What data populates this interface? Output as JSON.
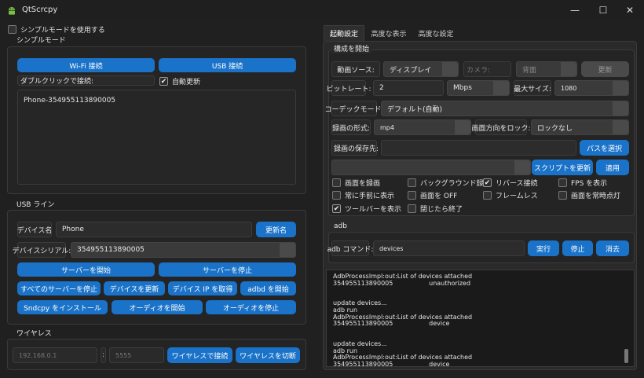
{
  "window": {
    "title": "QtScrcpy",
    "minimize": "—",
    "maximize": "☐",
    "close": "✕"
  },
  "simple_mode": {
    "checkbox_label": "シンプルモードを使用する",
    "group_title": "シンプルモード",
    "wifi_button": "Wi-Fi 接続",
    "usb_button": "USB 接続",
    "doubleclick_label": "ダブルクリックで接続:",
    "auto_update_label": "自動更新",
    "devices": [
      "Phone-354955113890005"
    ]
  },
  "usb_line": {
    "group_title": "USB ライン",
    "device_name_label": "デバイス名",
    "device_name_value": "Phone",
    "rename_button": "更新名",
    "serial_label": "デバイスシリアル:",
    "serial_value": "354955113890005",
    "start_server": "サーバーを開始",
    "stop_server": "サーバーを停止",
    "stop_all_servers": "すべてのサーバーを停止",
    "update_device": "デバイスを更新",
    "get_ip": "デバイス IP を取得",
    "start_adbd": "adbd を開始",
    "install_sndcpy": "Sndcpy をインストール",
    "start_audio": "オーディオを開始",
    "stop_audio": "オーディオを停止"
  },
  "wireless": {
    "group_title": "ワイヤレス",
    "ip_placeholder": "192.168.0.1",
    "separator": ":",
    "port_placeholder": "5555",
    "connect_button": "ワイヤレスで接続",
    "disconnect_button": "ワイヤレスを切断"
  },
  "tabs": [
    {
      "label": "起動設定",
      "active": true
    },
    {
      "label": "高度な表示",
      "active": false
    },
    {
      "label": "高度な設定",
      "active": false
    }
  ],
  "start_config": {
    "group_title": "構成を開始",
    "video_source_label": "動画ソース:",
    "video_source_value": "ディスプレイ",
    "camera_label": "カメラ:",
    "camera_position": "背面",
    "refresh_button": "更新",
    "bitrate_label": "ビットレート:",
    "bitrate_value": "2",
    "bitrate_unit": "Mbps",
    "max_size_label": "最大サイズ:",
    "max_size_value": "1080",
    "codec_label": "コーデックモード:",
    "codec_value": "デフォルト(自動)",
    "record_format_label": "録画の形式:",
    "record_format_value": "mp4",
    "lock_orientation_label": "画面方向をロック:",
    "lock_orientation_value": "ロックなし",
    "record_path_label": "録画の保存先:",
    "record_path_value": "",
    "select_path_button": "パスを選択",
    "script_value": "",
    "update_script_button": "スクリプトを更新",
    "apply_button": "適用",
    "options": [
      {
        "label": "画面を録画",
        "checked": false
      },
      {
        "label": "バックグラウンド録画",
        "checked": false
      },
      {
        "label": "リバース接続",
        "checked": true
      },
      {
        "label": "FPS を表示",
        "checked": false
      },
      {
        "label": "常に手前に表示",
        "checked": false
      },
      {
        "label": "画面を OFF",
        "checked": false
      },
      {
        "label": "フレームレス",
        "checked": false
      },
      {
        "label": "画面を常時点灯",
        "checked": false
      },
      {
        "label": "ツールバーを表示",
        "checked": true
      },
      {
        "label": "閉じたら終了",
        "checked": false
      }
    ]
  },
  "adb": {
    "group_title": "adb",
    "command_label": "adb コマンド:",
    "command_value": "devices",
    "execute_button": "実行",
    "stop_button": "停止",
    "clear_button": "消去"
  },
  "log_text": "AdbProcessImpl:out:List of devices attached\n354955113890005                  unauthorized\n\n\nupdate devices...\nadb run\nAdbProcessImpl:out:List of devices attached\n354955113890005                  device\n\n\nupdate devices...\nadb run\nAdbProcessImpl:out:List of devices attached\n354955113890005                  device",
  "colors": {
    "accent": "#1a73c9",
    "background": "#202020",
    "panel": "#242424"
  }
}
